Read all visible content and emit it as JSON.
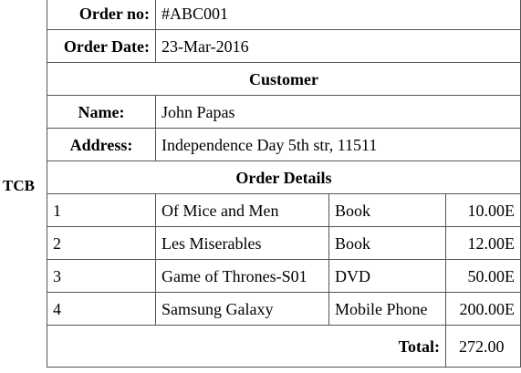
{
  "side_label": "TCB",
  "order": {
    "number_label": "Order no:",
    "number_value": "#ABC001",
    "date_label": "Order Date:",
    "date_value": "23-Mar-2016"
  },
  "customer": {
    "heading": "Customer",
    "name_label": "Name:",
    "name_value": "John Papas",
    "address_label": "Address:",
    "address_value": "Independence Day 5th str, 11511"
  },
  "details": {
    "heading": "Order Details",
    "items": [
      {
        "no": "1",
        "title": "Of Mice and Men",
        "type": "Book",
        "price": "10.00E"
      },
      {
        "no": "2",
        "title": "Les Miserables",
        "type": "Book",
        "price": "12.00E"
      },
      {
        "no": "3",
        "title": "Game of Thrones-S01",
        "type": "DVD",
        "price": "50.00E"
      },
      {
        "no": "4",
        "title": "Samsung Galaxy",
        "type": "Mobile Phone",
        "price": "200.00E"
      }
    ],
    "total_label": "Total:",
    "total_value": "272.00"
  }
}
